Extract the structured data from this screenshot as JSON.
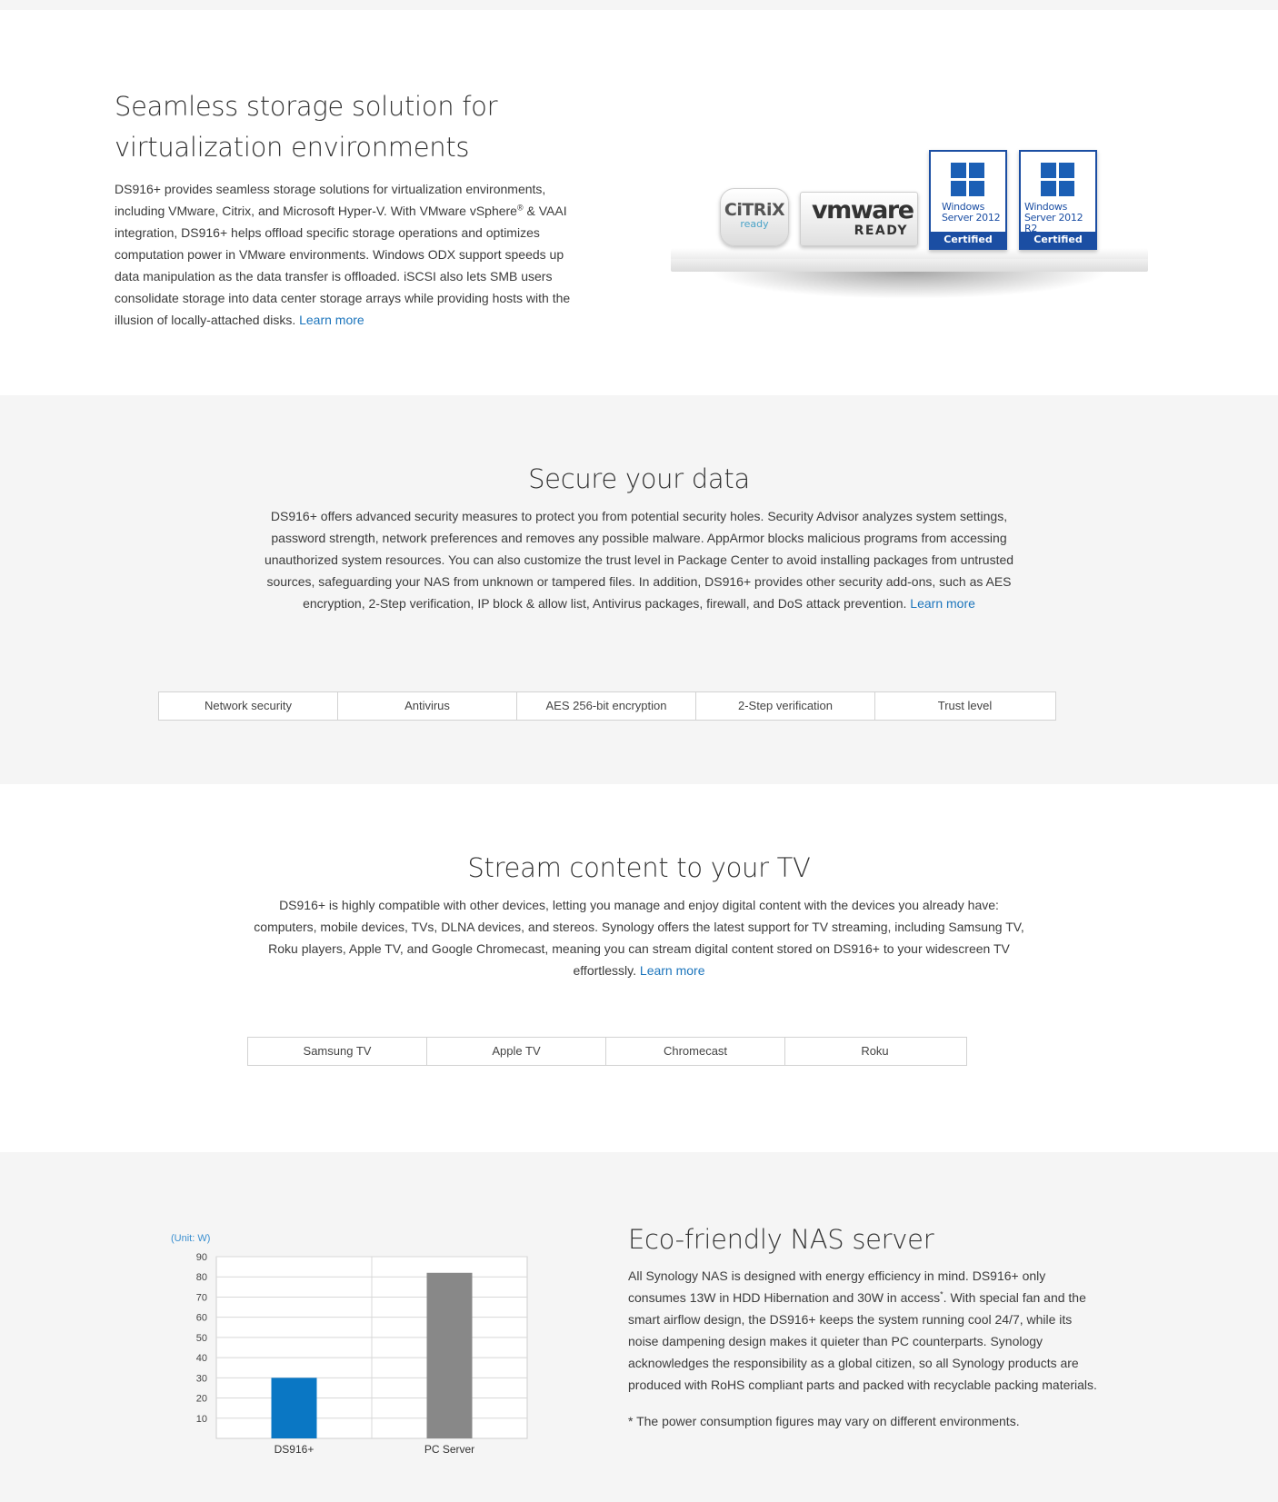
{
  "virtualization": {
    "title_line1": "Seamless storage solution for",
    "title_line2": "virtualization environments",
    "body_part1": "DS916+ provides seamless storage solutions for virtualization environments, including VMware, Citrix, and Microsoft Hyper-V. With VMware vSphere",
    "sup": "®",
    "body_part2": " & VAAI integration, DS916+ helps offload specific storage operations and optimizes computation power in VMware environments. Windows ODX support speeds up data manipulation as the data transfer is offloaded. iSCSI also lets SMB users consolidate storage into data center storage arrays while providing hosts with the illusion of locally-attached disks. ",
    "learn_more": "Learn more",
    "badges": {
      "citrix_main": "CiTRiX",
      "citrix_sub": "ready",
      "vmware_main": "vmware",
      "vmware_sub": "READY",
      "win1_line1": "Windows",
      "win1_line2": "Server 2012",
      "win1_cert": "Certified",
      "win2_line1": "Windows",
      "win2_line2": "Server 2012 R2",
      "win2_cert": "Certified"
    }
  },
  "secure": {
    "title": "Secure your data",
    "body": "DS916+ offers advanced security measures to protect you from potential security holes. Security Advisor analyzes system settings, password strength, network preferences and removes any possible malware. AppArmor blocks malicious programs from accessing unauthorized system resources. You can also customize the trust level in Package Center to avoid installing packages from untrusted sources, safeguarding your NAS from unknown or tampered files. In addition, DS916+ provides other security add-ons, such as AES encryption, 2-Step verification, IP block & allow list, Antivirus packages, firewall, and DoS attack prevention. ",
    "learn_more": "Learn more",
    "tabs": [
      "Network security",
      "Antivirus",
      "AES 256-bit encryption",
      "2-Step verification",
      "Trust level"
    ]
  },
  "stream": {
    "title": "Stream content to your TV",
    "body": "DS916+ is highly compatible with other devices, letting you manage and enjoy digital content with the devices you already have: computers, mobile devices, TVs, DLNA devices, and stereos. Synology offers the latest support for TV streaming, including Samsung TV, Roku players, Apple TV, and Google Chromecast, meaning you can stream digital content stored on DS916+ to your widescreen TV effortlessly. ",
    "learn_more": "Learn more",
    "tabs": [
      "Samsung TV",
      "Apple TV",
      "Chromecast",
      "Roku"
    ]
  },
  "eco": {
    "title": "Eco-friendly NAS server",
    "body_part1": "All Synology NAS is designed with energy efficiency in mind. DS916+ only consumes 13W in HDD Hibernation and 30W in access",
    "sup": "*",
    "body_part2": ". With special fan and the smart airflow design, the DS916+ keeps the system running cool 24/7, while its noise dampening design makes it quieter than PC counterparts. Synology acknowledges the responsibility as a global citizen, so all Synology products are produced with RoHS compliant parts and packed with recyclable packing materials.",
    "note": "* The power consumption figures may vary on different environments."
  },
  "chart_data": {
    "type": "bar",
    "unit_label": "(Unit: W)",
    "categories": [
      "DS916+",
      "PC Server"
    ],
    "values": [
      30,
      82
    ],
    "colors": [
      "#0a77c4",
      "#888888"
    ],
    "yticks": [
      10,
      20,
      30,
      40,
      50,
      60,
      70,
      80,
      90
    ],
    "ylim": [
      0,
      90
    ],
    "grid": true
  }
}
